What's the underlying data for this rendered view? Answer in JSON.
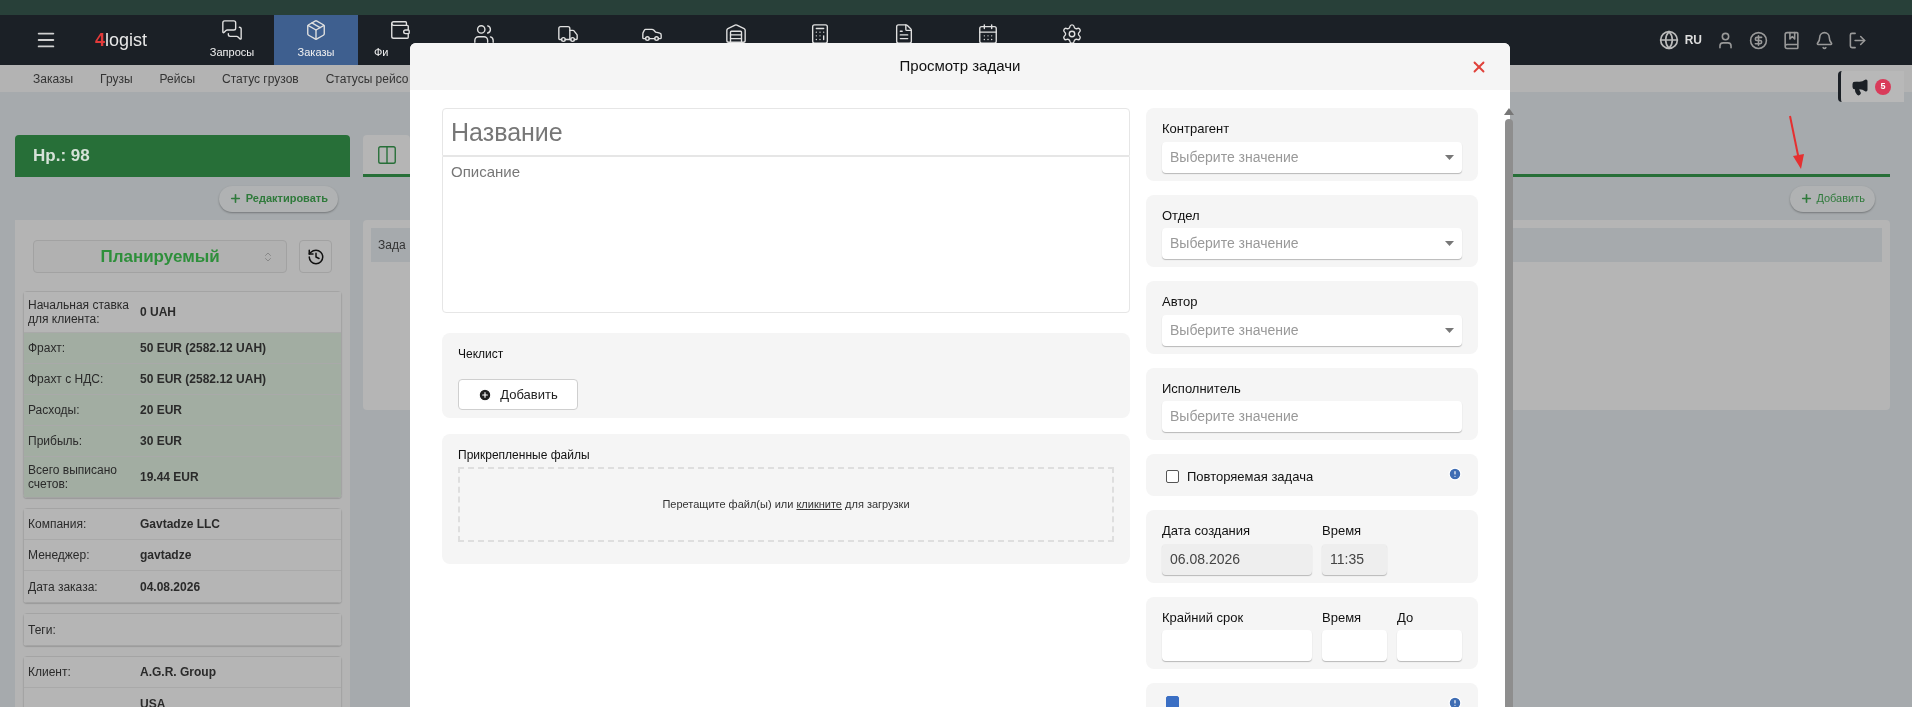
{
  "top_nav": {
    "logo_accent": "4",
    "logo": "logist",
    "items": [
      {
        "label": "Запросы",
        "selected": false
      },
      {
        "label": "Заказы",
        "selected": true
      },
      {
        "label": "Фи",
        "selected": false
      }
    ],
    "language": "RU"
  },
  "sub_nav": [
    "Заказы",
    "Грузы",
    "Рейсы",
    "Статус грузов",
    "Статусы рейсо"
  ],
  "announcements": {
    "count": "5"
  },
  "order_panel": {
    "title": "Нр.: 98",
    "edit_button": "Редактировать",
    "status": "Планируемый",
    "groups": [
      {
        "rows": [
          {
            "label": "Начальная ставка для клиента:",
            "value": "0 UAH",
            "highlighted": false
          },
          {
            "label": "Фрахт:",
            "value": "50 EUR (2582.12 UAH)",
            "highlighted": true
          },
          {
            "label": "Фрахт с НДС:",
            "value": "50 EUR (2582.12 UAH)",
            "highlighted": true
          },
          {
            "label": "Расходы:",
            "value": "20 EUR",
            "highlighted": true
          },
          {
            "label": "Прибыль:",
            "value": "30 EUR",
            "highlighted": true
          },
          {
            "label": "Всего выписано счетов:",
            "value": "19.44 EUR",
            "highlighted": true
          }
        ]
      },
      {
        "rows": [
          {
            "label": "Компания:",
            "value": "Gavtadze LLC",
            "highlighted": false
          },
          {
            "label": "Менеджер:",
            "value": "gavtadze",
            "highlighted": false
          },
          {
            "label": "Дата заказа:",
            "value": "04.08.2026",
            "highlighted": false
          }
        ]
      },
      {
        "rows": [
          {
            "label": "Теги:",
            "highlighted": false
          }
        ]
      },
      {
        "rows": [
          {
            "label": "Клиент:",
            "value": "A.G.R. Group",
            "highlighted": false
          },
          {
            "value": "USA",
            "highlighted": false
          }
        ]
      }
    ]
  },
  "tasks_panel": {
    "row_text": "Зада",
    "add_button": "Добавить"
  },
  "modal": {
    "title": "Просмотр задачи",
    "name_placeholder": "Название",
    "description_placeholder": "Описание",
    "checklist": {
      "label": "Чеклист",
      "add_button": "Добавить"
    },
    "files": {
      "label": "Прикрепленные файлы",
      "hint_before": "Перетащите файл(ы) или",
      "link": "кликните",
      "hint_after": "для загрузки"
    },
    "fields": [
      {
        "kind": "select",
        "label": "Контрагент",
        "placeholder": "Выберите значение",
        "dropdown": true
      },
      {
        "kind": "select",
        "label": "Отдел",
        "placeholder": "Выберите значение",
        "dropdown": true
      },
      {
        "kind": "select",
        "label": "Автор",
        "placeholder": "Выберите значение",
        "dropdown": true
      },
      {
        "kind": "select",
        "label": "Исполнитель",
        "placeholder": "Выберите значение",
        "dropdown": false
      },
      {
        "kind": "checkbox",
        "label": "Повторяемая задача",
        "checked": false
      },
      {
        "kind": "datetime",
        "inputs": [
          {
            "label": "Дата создания",
            "value": "06.08.2026",
            "disabled": true
          },
          {
            "label": "Время",
            "value": "11:35",
            "disabled": true
          }
        ]
      },
      {
        "kind": "datetime",
        "inputs": [
          {
            "label": "Крайний срок",
            "disabled": false
          },
          {
            "label": "Время",
            "disabled": false
          },
          {
            "label": "До",
            "disabled": false
          }
        ]
      },
      {
        "kind": "checkbox",
        "checked": true
      }
    ]
  }
}
